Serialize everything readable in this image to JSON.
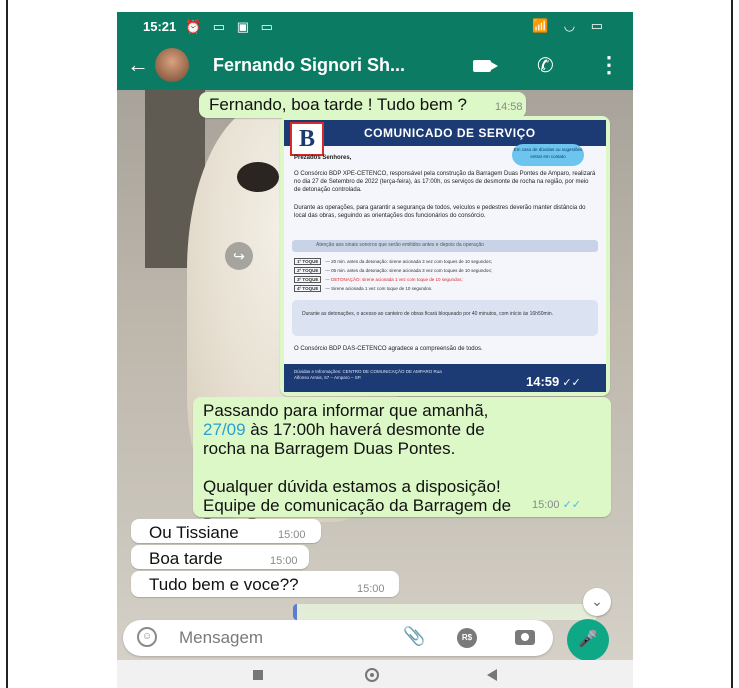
{
  "status_bar": {
    "time": "15:21",
    "left_icons": "⏰ ▭ ▣ ▭",
    "right_icons": "📶 ◡ ▭"
  },
  "header": {
    "back_icon": "←",
    "contact_name": "Fernando Signori Sh...",
    "call_icon": "✆",
    "menu_icon": "⋮"
  },
  "messages": [
    {
      "text": "Fernando, boa tarde ! Tudo bem ?",
      "time": "14:58",
      "ticks": "✓✓"
    },
    {
      "image_time": "14:59",
      "ticks": "✓✓"
    },
    {
      "text_line1": "Passando para informar que amanhã,",
      "date": "27/09",
      "text_line2": " às 17:00h haverá desmonte de",
      "text_rest": "rocha na Barragem Duas Pontes.\n\nQualquer dúvida estamos a disposição!\nEquipe de comunicação da Barragem de\nDuas Pontes",
      "time": "15:00",
      "ticks": "✓✓"
    },
    {
      "text": "Ou Tissiane",
      "time": "15:00"
    },
    {
      "text": "Boa tarde",
      "time": "15:00"
    },
    {
      "text": "Tudo bem e voce??",
      "time": "15:00"
    }
  ],
  "poster": {
    "logo": "B",
    "title": "COMUNICADO DE SERVIÇO",
    "cloud": "Em caso de dúvidas ou sugestões entrar em contato",
    "greeting": "Prezados Senhores,",
    "para1": "O Consórcio BDP XPE-CETENCO, responsável pela construção da Barragem Duas Pontes de Amparo, realizará no dia 27 de Setembro de 2022 (terça-feira), às 17:00h, os serviços de desmonte de rocha na região, por meio de detonação controlada.",
    "para2": "Durante as operações, para garantir a segurança de todos, veículos e pedestres deverão manter distância do local das obras, seguindo as orientações dos funcionários do consórcio.",
    "band": "Atenção aos sinais sonoros que serão emitidos antes e depois da operação",
    "rows": [
      {
        "tag": "1º TOQUE",
        "text": "— 20 min. antes da detonação: sirene acionada 3 vez com toques de 10 segundos;",
        "red": false
      },
      {
        "tag": "2º TOQUE",
        "text": "— 05 min. antes da detonação: sirene acionada 3 vez com toques de 10 segundos;",
        "red": false
      },
      {
        "tag": "3º TOQUE",
        "text": "— DETONAÇÃO: sirene acionada 1 vez com toque de 10 segundos;",
        "red": true
      },
      {
        "tag": "4º TOQUE",
        "text": "— Sirene acionada 1 vez com toque de 10 segundos.",
        "red": false
      }
    ],
    "box": "Durante as detonações, o acesso ao canteiro de obras ficará bloqueado por 40 minutos, com início às 16h50min.",
    "thanks": "O Consórcio BDP DAS-CETENCO agradece a compreensão de todos.",
    "footer": "Dúvidas e Informações: CENTRO DE COMUNICAÇÃO DE AMPARO Rua Alfonso Arrais, 67 – Amparo – SP."
  },
  "input": {
    "placeholder": "Mensagem",
    "emoji_icon": "☺",
    "attach_icon": "📎",
    "pay_icon": "R$",
    "mic_icon": "🎤"
  },
  "scroll_icon": "⌄",
  "share_icon": "↪"
}
